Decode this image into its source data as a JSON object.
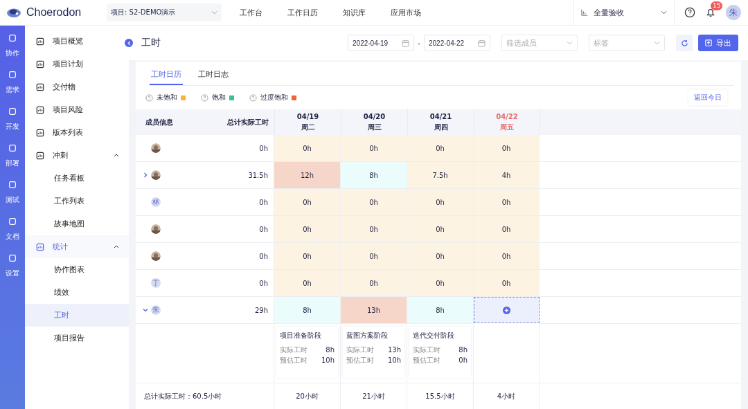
{
  "header": {
    "logo": "Choerodon",
    "project": "项目: S2-DEMO演示",
    "nav": [
      "工作台",
      "工作日历",
      "知识库",
      "应用市场"
    ],
    "scope": "全量验收",
    "notifications": "15",
    "avatar": "朱"
  },
  "rail": [
    "协作",
    "需求",
    "开发",
    "部署",
    "测试",
    "文档",
    "设置"
  ],
  "sidebar": [
    {
      "label": "项目概览",
      "kind": "link",
      "selected": false
    },
    {
      "label": "项目计划",
      "kind": "link",
      "selected": false
    },
    {
      "label": "交付物",
      "kind": "link",
      "selected": false
    },
    {
      "label": "项目风险",
      "kind": "link",
      "selected": false
    },
    {
      "label": "版本列表",
      "kind": "link",
      "selected": false
    },
    {
      "label": "冲刺",
      "kind": "group",
      "selected": false,
      "expanded": true,
      "children": [
        {
          "label": "任务看板",
          "selected": false
        },
        {
          "label": "工作列表",
          "selected": false
        },
        {
          "label": "故事地图",
          "selected": false
        }
      ]
    },
    {
      "label": "统计",
      "kind": "group",
      "selected": true,
      "expanded": true,
      "children": [
        {
          "label": "协作图表",
          "selected": false
        },
        {
          "label": "绩效",
          "selected": false
        },
        {
          "label": "工时",
          "selected": true
        },
        {
          "label": "项目报告",
          "selected": false
        }
      ]
    }
  ],
  "page": {
    "title": "工时",
    "start_date": "2022-04-19",
    "end_date": "2022-04-22",
    "date_separator": "-",
    "member_filter": {
      "placeholder": "筛选成员"
    },
    "tag_filter": {
      "placeholder": "标签"
    },
    "export": "导出"
  },
  "tabs": [
    {
      "label": "工时日历",
      "selected": true
    },
    {
      "label": "工时日志",
      "selected": false
    }
  ],
  "legend": [
    {
      "label": "未饱和",
      "color": "#f5b33a"
    },
    {
      "label": "饱和",
      "color": "#3dbf8f"
    },
    {
      "label": "过度饱和",
      "color": "#f0643c"
    }
  ],
  "back_today": "返回今日",
  "table": {
    "columns": [
      "成员信息",
      "总计实际工时"
    ],
    "days": [
      {
        "date": "04/19",
        "weekday": "周二",
        "today": false
      },
      {
        "date": "04/20",
        "weekday": "周三",
        "today": false
      },
      {
        "date": "04/21",
        "weekday": "周四",
        "today": false
      },
      {
        "date": "04/22",
        "weekday": "周五",
        "today": true
      }
    ],
    "rows": [
      {
        "total": "0h",
        "cells": [
          {
            "kind": "hours",
            "hours": "0h",
            "color": "#fdf3e2"
          },
          {
            "kind": "hours",
            "hours": "0h",
            "color": "#fdf3e2"
          },
          {
            "kind": "hours",
            "hours": "0h",
            "color": "#fdf3e2"
          },
          {
            "kind": "hours",
            "hours": "0h",
            "color": "#fdf3e2"
          }
        ]
      },
      {
        "expanded": false,
        "total": "31.5h",
        "cells": [
          {
            "kind": "hours",
            "hours": "12h",
            "color": "#f7d6ca"
          },
          {
            "kind": "hours",
            "hours": "8h",
            "color": "#eafcfb"
          },
          {
            "kind": "hours",
            "hours": "7.5h",
            "color": "#fdf3e2"
          },
          {
            "kind": "hours",
            "hours": "4h",
            "color": "#fdf3e2"
          }
        ]
      },
      {
        "avatar": {
          "kind": "initial",
          "text": "林"
        },
        "total": "0h",
        "cells": [
          {
            "kind": "hours",
            "hours": "0h",
            "color": "#fdf3e2"
          },
          {
            "kind": "hours",
            "hours": "0h",
            "color": "#fdf3e2"
          },
          {
            "kind": "hours",
            "hours": "0h",
            "color": "#fdf3e2"
          },
          {
            "kind": "hours",
            "hours": "0h",
            "color": "#fdf3e2"
          }
        ]
      },
      {
        "total": "0h",
        "cells": [
          {
            "kind": "hours",
            "hours": "0h",
            "color": "#fdf3e2"
          },
          {
            "kind": "hours",
            "hours": "0h",
            "color": "#fdf3e2"
          },
          {
            "kind": "hours",
            "hours": "0h",
            "color": "#fdf3e2"
          },
          {
            "kind": "hours",
            "hours": "0h",
            "color": "#fdf3e2"
          }
        ]
      },
      {
        "total": "0h",
        "cells": [
          {
            "kind": "hours",
            "hours": "0h",
            "color": "#fdf3e2"
          },
          {
            "kind": "hours",
            "hours": "0h",
            "color": "#fdf3e2"
          },
          {
            "kind": "hours",
            "hours": "0h",
            "color": "#fdf3e2"
          },
          {
            "kind": "hours",
            "hours": "0h",
            "color": "#fdf3e2"
          }
        ]
      },
      {
        "avatar": {
          "kind": "initial",
          "text": "丁"
        },
        "total": "0h",
        "cells": [
          {
            "kind": "hours",
            "hours": "0h",
            "color": "#fdf3e2"
          },
          {
            "kind": "hours",
            "hours": "0h",
            "color": "#fdf3e2"
          },
          {
            "kind": "hours",
            "hours": "0h",
            "color": "#fdf3e2"
          },
          {
            "kind": "hours",
            "hours": "0h",
            "color": "#fdf3e2"
          }
        ]
      },
      {
        "avatar": {
          "kind": "initial",
          "text": "朱"
        },
        "expanded": true,
        "total": "29h",
        "cells": [
          {
            "kind": "hours",
            "hours": "8h",
            "color": "#eafcfb"
          },
          {
            "kind": "hours",
            "hours": "13h",
            "color": "#f7d6ca"
          },
          {
            "kind": "hours",
            "hours": "8h",
            "color": "#eafcfb"
          },
          {
            "kind": "add"
          }
        ],
        "details": [
          {
            "phase": "项目准备阶段",
            "actual_label": "实际工时",
            "actual": "8h",
            "estimate_label": "预估工时",
            "estimate": "10h"
          },
          {
            "phase": "蓝图方案阶段",
            "actual_label": "实际工时",
            "actual": "13h",
            "estimate_label": "预估工时",
            "estimate": "10h"
          },
          {
            "phase": "迭代交付阶段",
            "actual_label": "实际工时",
            "actual": "8h",
            "estimate_label": "预估工时",
            "estimate": "0h"
          }
        ]
      }
    ],
    "footer": {
      "label": "总计实际工时：60.5小时",
      "days": [
        "20小时",
        "21小时",
        "15.5小时",
        "4小时"
      ]
    }
  }
}
